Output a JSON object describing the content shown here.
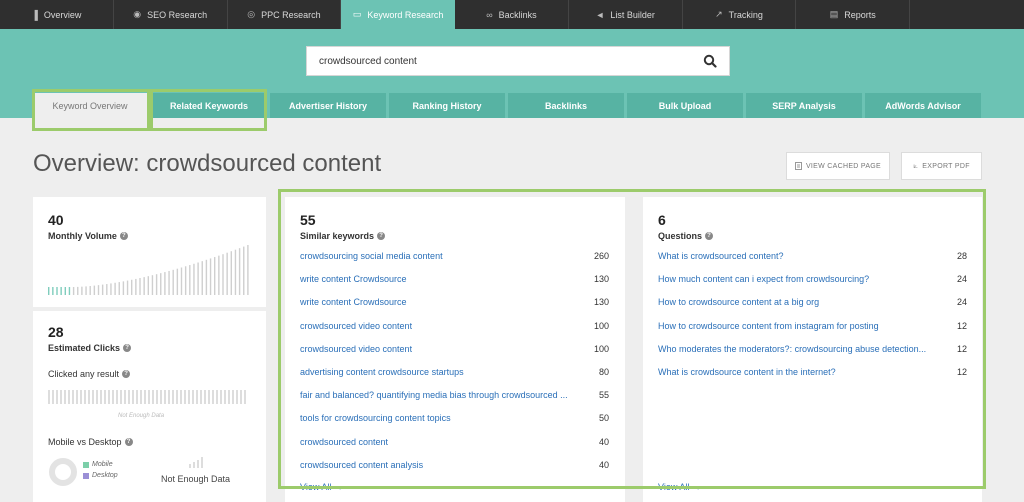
{
  "topnav": [
    {
      "label": "Overview",
      "icon": "bar-chart-icon",
      "active": false
    },
    {
      "label": "SEO Research",
      "icon": "eye-icon",
      "active": false
    },
    {
      "label": "PPC Research",
      "icon": "target-icon",
      "active": false
    },
    {
      "label": "Keyword Research",
      "icon": "keyboard-icon",
      "active": true
    },
    {
      "label": "Backlinks",
      "icon": "link-icon",
      "active": false
    },
    {
      "label": "List Builder",
      "icon": "megaphone-icon",
      "active": false
    },
    {
      "label": "Tracking",
      "icon": "line-chart-icon",
      "active": false
    },
    {
      "label": "Reports",
      "icon": "document-icon",
      "active": false
    }
  ],
  "search": {
    "value": "crowdsourced content"
  },
  "subtabs": [
    {
      "label": "Keyword Overview",
      "active": true
    },
    {
      "label": "Related Keywords",
      "active": false
    },
    {
      "label": "Advertiser History",
      "active": false
    },
    {
      "label": "Ranking History",
      "active": false
    },
    {
      "label": "Backlinks",
      "active": false
    },
    {
      "label": "Bulk Upload",
      "active": false
    },
    {
      "label": "SERP Analysis",
      "active": false
    },
    {
      "label": "AdWords Advisor",
      "active": false
    }
  ],
  "title": "Overview: crowdsourced content",
  "buttons": {
    "cached": "VIEW CACHED PAGE",
    "pdf": "EXPORT PDF"
  },
  "volume": {
    "value": "40",
    "label": "Monthly Volume"
  },
  "clicks": {
    "value": "28",
    "label": "Estimated Clicks",
    "clicked_label": "Clicked any result",
    "not_enough": "Not Enough Data",
    "mobile_label": "Mobile vs Desktop",
    "legend_mobile": "Mobile",
    "legend_desktop": "Desktop",
    "mobile_not_enough": "Not Enough Data"
  },
  "similar": {
    "value": "55",
    "label": "Similar keywords",
    "view_all": "View All →",
    "items": [
      {
        "kw": "crowdsourcing social media content",
        "n": "260"
      },
      {
        "kw": "write content Crowdsource",
        "n": "130"
      },
      {
        "kw": "write content Crowdsource",
        "n": "130"
      },
      {
        "kw": "crowdsourced video content",
        "n": "100"
      },
      {
        "kw": "crowdsourced video content",
        "n": "100"
      },
      {
        "kw": "advertising content crowdsource startups",
        "n": "80"
      },
      {
        "kw": "fair and balanced? quantifying media bias through crowdsourced ...",
        "n": "55"
      },
      {
        "kw": "tools for crowdsourcing content topics",
        "n": "50"
      },
      {
        "kw": "crowdsourced content",
        "n": "40"
      },
      {
        "kw": "crowdsourced content analysis",
        "n": "40"
      }
    ]
  },
  "questions": {
    "value": "6",
    "label": "Questions",
    "view_all": "View All →",
    "items": [
      {
        "kw": "What is crowdsourced content?",
        "n": "28"
      },
      {
        "kw": "How much content can i expect from crowdsourcing?",
        "n": "24"
      },
      {
        "kw": "How to crowdsource content at a big org",
        "n": "24"
      },
      {
        "kw": "How to crowdsource content from instagram for posting",
        "n": "12"
      },
      {
        "kw": "Who moderates the moderators?: crowdsourcing abuse detection...",
        "n": "12"
      },
      {
        "kw": "What is crowdsource content in the internet?",
        "n": "12"
      }
    ]
  },
  "colors": {
    "teal": "#6cc3b4",
    "teal_dark": "#57b3a3",
    "highlight": "#9ccb6b",
    "link": "#2a6fb8",
    "mobile": "#7ccfa9",
    "desktop": "#9b8fd6"
  }
}
